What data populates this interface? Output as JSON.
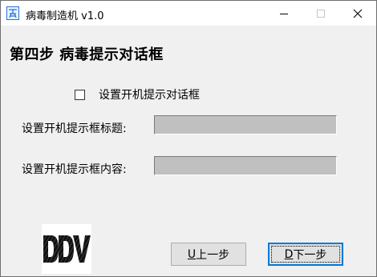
{
  "window": {
    "title": "病毒制造机 v1.0"
  },
  "step": {
    "title": "第四步  病毒提示对话框"
  },
  "checkbox": {
    "label": "设置开机提示对话框",
    "checked": false
  },
  "fields": {
    "title_label": "设置开机提示框标题:",
    "title_value": "",
    "content_label": "设置开机提示框内容:",
    "content_value": ""
  },
  "logo": {
    "text": "DDV"
  },
  "buttons": {
    "prev_key": "U",
    "prev_label": " 上一步",
    "next_key": "D",
    "next_label": " 下一步"
  },
  "colors": {
    "input_bg": "#c0c0c0",
    "window_bg": "#f0f0f0"
  }
}
